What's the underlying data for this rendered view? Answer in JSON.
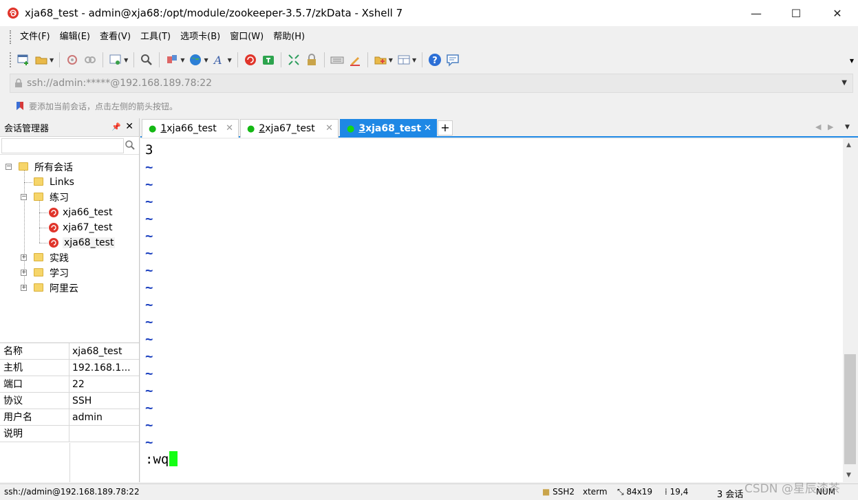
{
  "window": {
    "title": "xja68_test - admin@xja68:/opt/module/zookeeper-3.5.7/zkData - Xshell 7",
    "minimize": "—",
    "maximize": "☐",
    "close": "✕"
  },
  "menu": [
    "文件(F)",
    "编辑(E)",
    "查看(V)",
    "工具(T)",
    "选项卡(B)",
    "窗口(W)",
    "帮助(H)"
  ],
  "address": {
    "value": "ssh://admin:*****@192.168.189.78:22"
  },
  "hint": "要添加当前会话，点击左侧的箭头按钮。",
  "session_manager": {
    "title": "会话管理器",
    "search_placeholder": "",
    "tree": {
      "root": "所有会话",
      "links": "Links",
      "practice": "练习",
      "sessions": [
        "xja66_test",
        "xja67_test",
        "xja68_test"
      ],
      "folders": [
        "实践",
        "学习",
        "阿里云"
      ]
    },
    "properties": [
      {
        "key": "名称",
        "value": "xja68_test"
      },
      {
        "key": "主机",
        "value": "192.168.1..."
      },
      {
        "key": "端口",
        "value": "22"
      },
      {
        "key": "协议",
        "value": "SSH"
      },
      {
        "key": "用户名",
        "value": "admin"
      },
      {
        "key": "说明",
        "value": ""
      }
    ]
  },
  "tabs": [
    {
      "num": "1",
      "label": " xja66_test"
    },
    {
      "num": "2",
      "label": " xja67_test"
    },
    {
      "num": "3",
      "label": " xja68_test"
    }
  ],
  "terminal": {
    "first_line": "3",
    "tilde": "~",
    "command": ":wq"
  },
  "status": {
    "connection": "ssh://admin@192.168.189.78:22",
    "protocol": "SSH2",
    "terminal_type": "xterm",
    "size": "84x19",
    "cursor_pos": "19,4",
    "sessions": "3 会话",
    "num": "NUM"
  },
  "watermark": "CSDN @星辰漆茶",
  "colors": {
    "accent": "#1e88e5",
    "cursor": "#14ff14",
    "tilde": "#1a3fbf"
  }
}
